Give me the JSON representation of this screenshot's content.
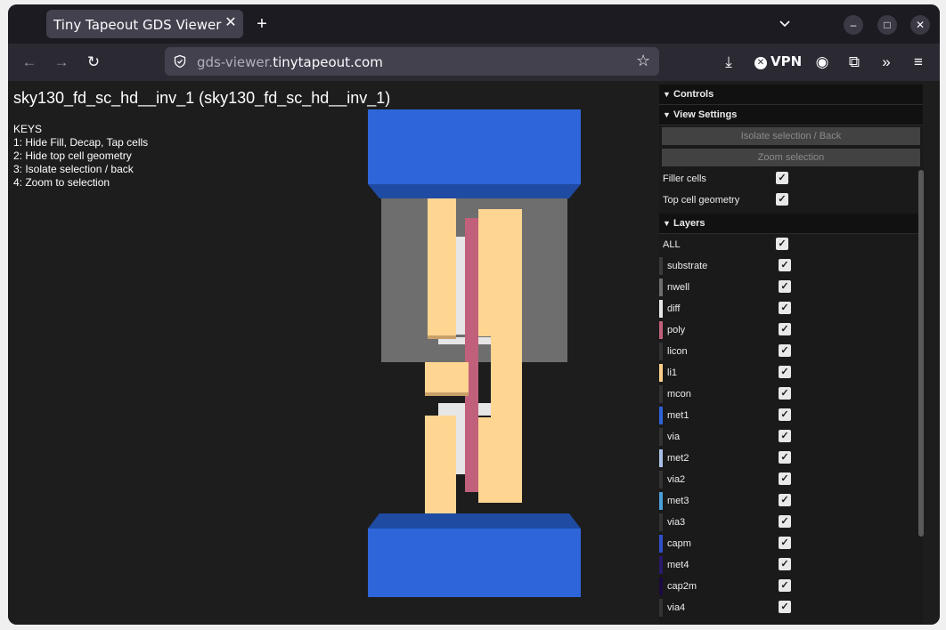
{
  "browser": {
    "tab_title": "Tiny Tapeout GDS Viewer",
    "url_prefix": "gds-viewer.",
    "url_domain": "tinytapeout.com",
    "vpn_label": "VPN"
  },
  "page": {
    "title": "sky130_fd_sc_hd__inv_1 (sky130_fd_sc_hd__inv_1)",
    "keys_heading": "KEYS",
    "keys": [
      "1: Hide Fill, Decap, Tap cells",
      "2: Hide top cell geometry",
      "3: Isolate selection / back",
      "4: Zoom to selection"
    ]
  },
  "panel": {
    "controls_label": "Controls",
    "view_settings_label": "View Settings",
    "isolate_button": "Isolate selection / Back",
    "zoom_button": "Zoom selection",
    "filler_cells_label": "Filler cells",
    "top_cell_geometry_label": "Top cell geometry",
    "layers_label": "Layers",
    "all_label": "ALL",
    "layers": [
      {
        "name": "substrate",
        "color": "#3a3a3a"
      },
      {
        "name": "nwell",
        "color": "#6e6e6e"
      },
      {
        "name": "diff",
        "color": "#e6e6e6"
      },
      {
        "name": "poly",
        "color": "#c0607a"
      },
      {
        "name": "licon",
        "color": "#333333"
      },
      {
        "name": "li1",
        "color": "#ffd08a"
      },
      {
        "name": "mcon",
        "color": "#333333"
      },
      {
        "name": "met1",
        "color": "#2e62d9"
      },
      {
        "name": "via",
        "color": "#333333"
      },
      {
        "name": "met2",
        "color": "#a8bfe6"
      },
      {
        "name": "via2",
        "color": "#333333"
      },
      {
        "name": "met3",
        "color": "#4aa0d8"
      },
      {
        "name": "via3",
        "color": "#333333"
      },
      {
        "name": "capm",
        "color": "#3050c8"
      },
      {
        "name": "met4",
        "color": "#2a1a6a"
      },
      {
        "name": "cap2m",
        "color": "#1a0a40"
      },
      {
        "name": "via4",
        "color": "#333333"
      }
    ]
  }
}
